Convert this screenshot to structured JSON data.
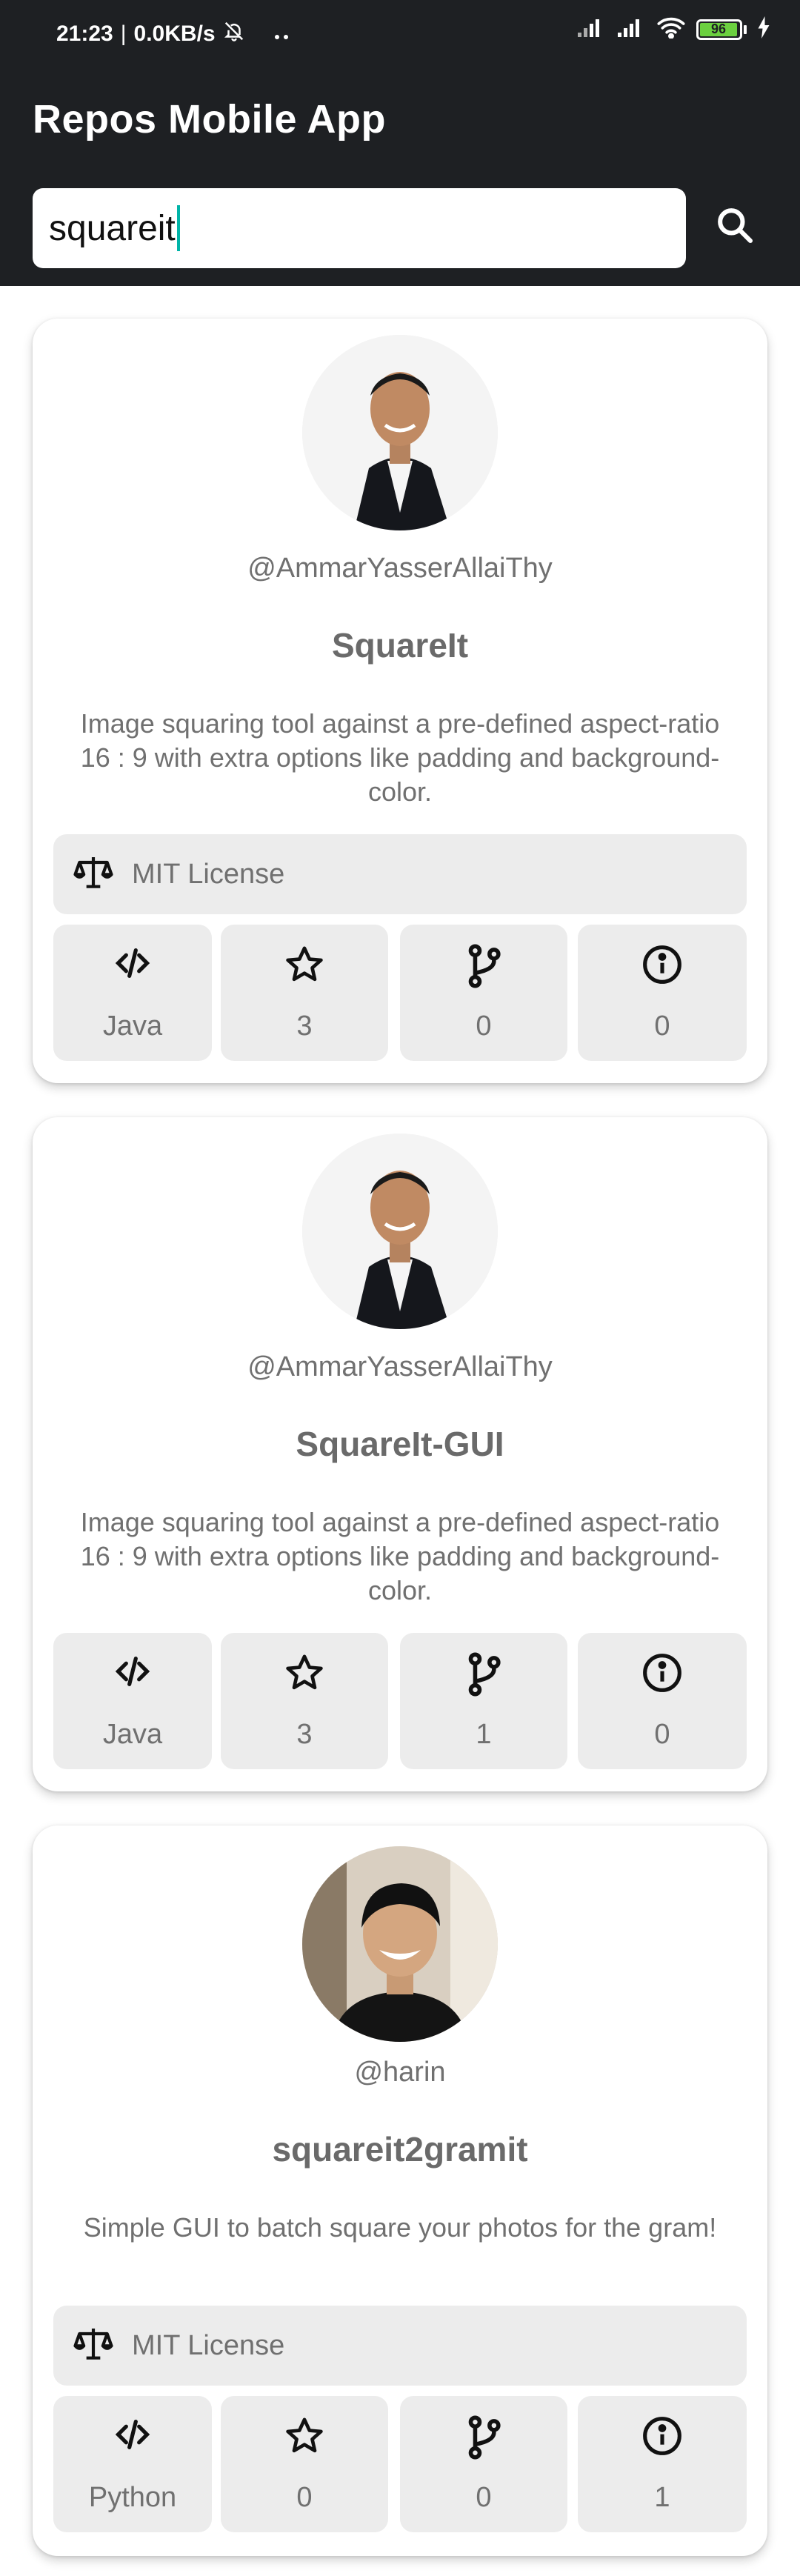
{
  "status_bar": {
    "time": "21:23",
    "network_speed": "0.0KB/s",
    "battery_level": "96",
    "icons": [
      "bell-off-icon",
      "more-dots-icon",
      "signal-icon",
      "signal-icon",
      "wifi-icon",
      "battery-icon",
      "charging-icon"
    ]
  },
  "app": {
    "title": "Repos Mobile App"
  },
  "search": {
    "value": "squareit",
    "placeholder": ""
  },
  "repos": [
    {
      "username": "@AmmarYasserAllaiThy",
      "name": "SquareIt",
      "description": "Image squaring tool against a pre-defined aspect-ratio 16 : 9 with extra options like padding and background-color.",
      "license": "MIT License",
      "language": "Java",
      "stars": "3",
      "forks": "0",
      "issues": "0"
    },
    {
      "username": "@AmmarYasserAllaiThy",
      "name": "SquareIt-GUI",
      "description": "Image squaring tool against a pre-defined aspect-ratio 16 : 9 with extra options like padding and background-color.",
      "language": "Java",
      "stars": "3",
      "forks": "1",
      "issues": "0"
    },
    {
      "username": "@harin",
      "name": "squareit2gramit",
      "description": "Simple GUI to batch square your photos for the gram!",
      "license": "MIT License",
      "language": "Python",
      "stars": "0",
      "forks": "0",
      "issues": "1"
    }
  ],
  "colors": {
    "app_bar": "#1e2023",
    "card_bg": "#ffffff",
    "chip_bg": "#ececec",
    "text_muted": "#707070",
    "caret": "#00b4a8",
    "battery": "#6bd03f"
  }
}
